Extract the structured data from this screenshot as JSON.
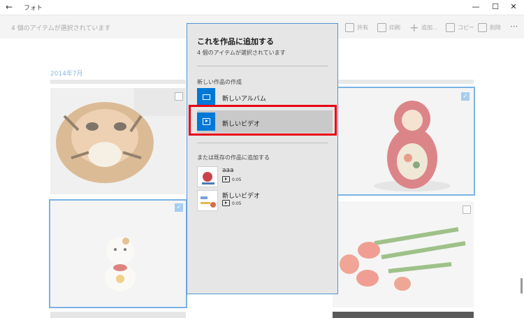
{
  "window": {
    "back_glyph": "←",
    "title": "フォト",
    "minimize": "—",
    "maximize": "☐",
    "close": "✕"
  },
  "commandbar": {
    "selection_text": "4 個のアイテムが選択されています",
    "share": "共有",
    "print": "印刷",
    "add": "追加...",
    "copy": "コピー",
    "delete": "削除",
    "more": "···"
  },
  "grid": {
    "month_label": "2014年7月",
    "check_glyph": "✓"
  },
  "flyout": {
    "title": "これを作品に追加する",
    "subtitle": "4 個のアイテムが選択されています",
    "new_section": "新しい作品の作成",
    "new_album": "新しいアルバム",
    "new_video": "新しいビデオ",
    "existing_section": "または既存の作品に追加する",
    "existing": [
      {
        "name": "aaa",
        "duration": "0:05"
      },
      {
        "name": "新しいビデオ",
        "duration": "0:05"
      }
    ]
  },
  "colors": {
    "accent": "#0078d7",
    "highlight_box": "#e60012",
    "selection_outline": "#7ab3e6"
  }
}
